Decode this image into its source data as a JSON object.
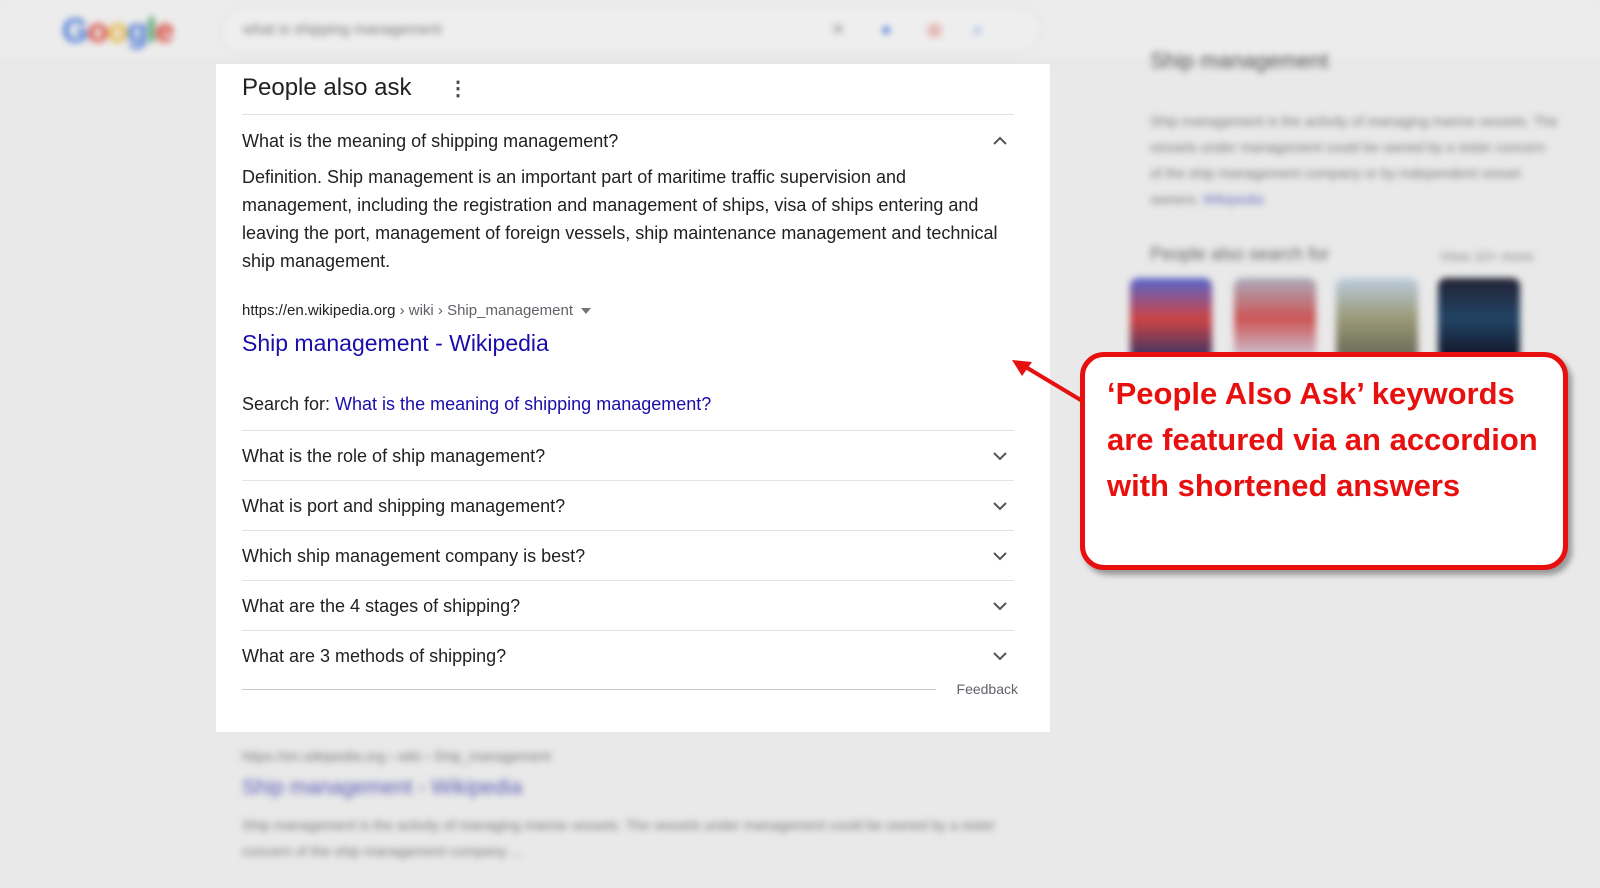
{
  "paa": {
    "title": "People also ask",
    "expanded_question": "What is the meaning of shipping management?",
    "answer": "Definition. Ship management is an important part of maritime traffic supervision and management, including the registration and management of ships, visa of ships entering and leaving the port, management of foreign vessels, ship maintenance management and technical ship management.",
    "source_url": "https://en.wikipedia.org",
    "source_crumb": " › wiki › Ship_management",
    "source_title": "Ship management - Wikipedia",
    "search_for_label": "Search for: ",
    "search_for_link": "What is the meaning of shipping management?",
    "questions": [
      "What is the role of ship management?",
      "What is port and shipping management?",
      "Which ship management company is best?",
      "What are the 4 stages of shipping?",
      "What are 3 methods of shipping?"
    ],
    "feedback": "Feedback"
  },
  "callout": {
    "text": "‘People Also Ask’ keywords are featured via an accordion with shortened answers",
    "color": "#e8100f"
  },
  "colors": {
    "link": "#1a0dab",
    "background": "#e9e9e9"
  }
}
